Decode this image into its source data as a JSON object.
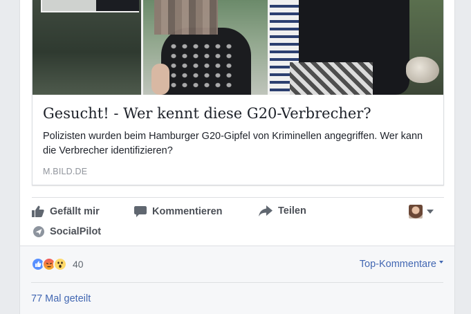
{
  "post": {
    "link_preview": {
      "title": "Gesucht! - Wer kennt diese G20-Verbrecher?",
      "description": "Polizisten wurden beim Hamburger G20-Gipfel von Kriminellen angegriffen. Wer kann die Verbrecher identifizieren?",
      "domain": "M.BILD.DE"
    },
    "actions": {
      "like": "Gefällt mir",
      "comment": "Kommentieren",
      "share": "Teilen",
      "app": "SocialPilot"
    },
    "reactions": {
      "count": "40",
      "types": [
        "like-icon",
        "angry-icon",
        "wow-icon"
      ]
    },
    "comments_sort": "Top-Kommentare",
    "shares": "77 Mal geteilt"
  },
  "colors": {
    "link_blue": "#4267b2",
    "action_gray": "#4b4f56",
    "like_blue": "#5890ff"
  }
}
